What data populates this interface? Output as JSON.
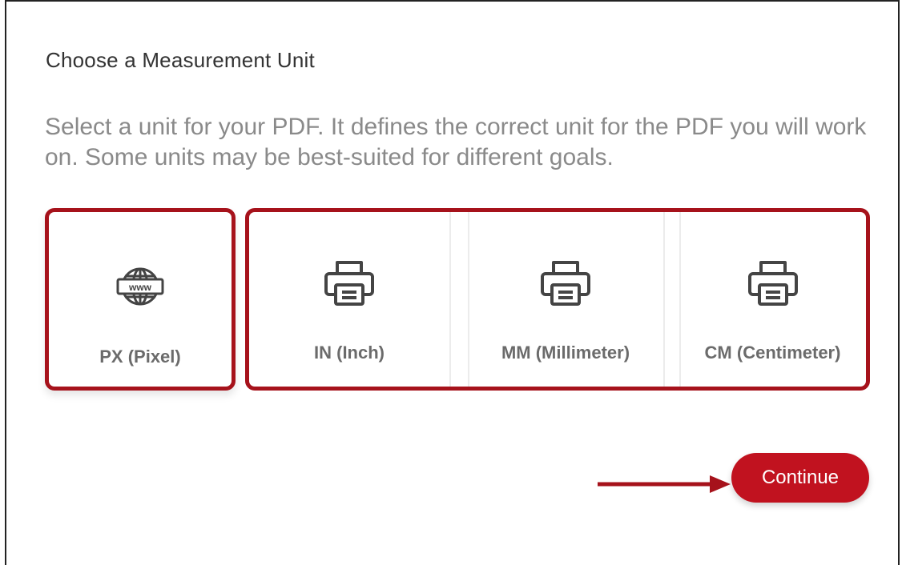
{
  "dialog": {
    "title": "Choose a Measurement Unit",
    "description": "Select a unit for your PDF. It defines the correct unit for the PDF you will work on. Some units may be best-suited for different goals."
  },
  "units": [
    {
      "label": "PX (Pixel)",
      "icon": "globe-www-icon"
    },
    {
      "label": "IN (Inch)",
      "icon": "printer-icon"
    },
    {
      "label": "MM (Millimeter)",
      "icon": "printer-icon"
    },
    {
      "label": "CM (Centimeter)",
      "icon": "printer-icon"
    }
  ],
  "actions": {
    "continue_label": "Continue"
  },
  "colors": {
    "accent": "#c1121f",
    "highlight_outline": "#a6121b",
    "label_text": "#6b6b6b",
    "description_text": "#8a8a8a"
  }
}
